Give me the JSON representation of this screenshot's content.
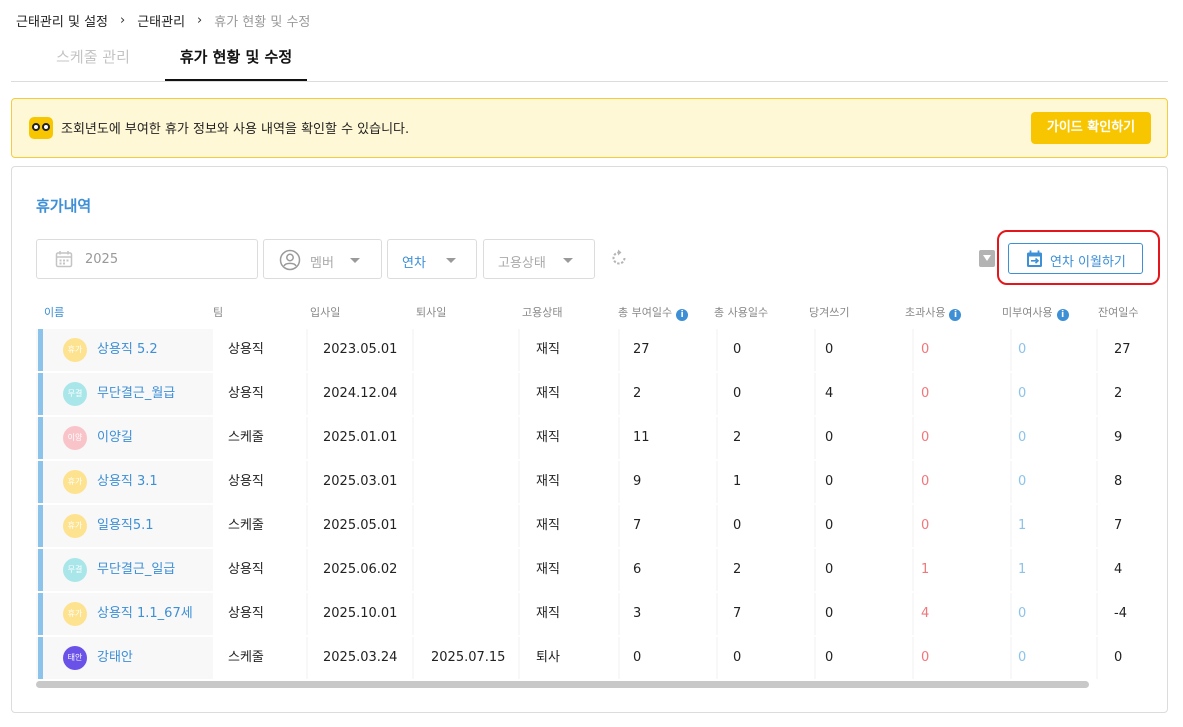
{
  "breadcrumb": {
    "items": [
      "근태관리 및 설정",
      "근태관리",
      "휴가 현황 및 수정"
    ],
    "separator": "›"
  },
  "tabs": [
    {
      "label": "스케줄 관리",
      "active": false
    },
    {
      "label": "휴가 현황 및 수정",
      "active": true
    }
  ],
  "notice": {
    "icon": "owl-mascot-icon",
    "message": "조회년도에 부여한 휴가 정보와 사용 내역을 확인할 수 있습니다.",
    "guide_button": "가이드 확인하기"
  },
  "section": {
    "title": "휴가내역"
  },
  "filters": {
    "year": "2025",
    "member_placeholder": "멤버",
    "leave_type": "연차",
    "employment_status_placeholder": "고용상태"
  },
  "actions": {
    "carryover_button": "연차 이월하기"
  },
  "table": {
    "columns": [
      "이름",
      "팀",
      "입사일",
      "퇴사일",
      "고용상태",
      "총 부여일수",
      "총 사용일수",
      "당겨쓰기",
      "초과사용",
      "미부여사용",
      "잔여일수"
    ],
    "info_icon": "i",
    "rows": [
      {
        "avatar": "휴가",
        "avatar_color": "#fde28f",
        "name": "상용직 5.2",
        "team": "상용직",
        "join": "2023.05.01",
        "leave": "",
        "status": "재직",
        "granted": "27",
        "used": "0",
        "advance": "0",
        "over": "0",
        "ungranted": "0",
        "remaining": "27"
      },
      {
        "avatar": "무결",
        "avatar_color": "#a9e6ea",
        "name": "무단결근_월급",
        "team": "상용직",
        "join": "2024.12.04",
        "leave": "",
        "status": "재직",
        "granted": "2",
        "used": "0",
        "advance": "4",
        "over": "0",
        "ungranted": "0",
        "remaining": "2"
      },
      {
        "avatar": "이양",
        "avatar_color": "#f9c4c9",
        "name": "이양길",
        "team": "스케줄",
        "join": "2025.01.01",
        "leave": "",
        "status": "재직",
        "granted": "11",
        "used": "2",
        "advance": "0",
        "over": "0",
        "ungranted": "0",
        "remaining": "9"
      },
      {
        "avatar": "휴가",
        "avatar_color": "#fde28f",
        "name": "상용직 3.1",
        "team": "상용직",
        "join": "2025.03.01",
        "leave": "",
        "status": "재직",
        "granted": "9",
        "used": "1",
        "advance": "0",
        "over": "0",
        "ungranted": "0",
        "remaining": "8"
      },
      {
        "avatar": "휴가",
        "avatar_color": "#fde28f",
        "name": "일용직5.1",
        "team": "스케줄",
        "join": "2025.05.01",
        "leave": "",
        "status": "재직",
        "granted": "7",
        "used": "0",
        "advance": "0",
        "over": "0",
        "ungranted": "1",
        "remaining": "7"
      },
      {
        "avatar": "무결",
        "avatar_color": "#a9e6ea",
        "name": "무단결근_일급",
        "team": "상용직",
        "join": "2025.06.02",
        "leave": "",
        "status": "재직",
        "granted": "6",
        "used": "2",
        "advance": "0",
        "over": "1",
        "ungranted": "1",
        "remaining": "4"
      },
      {
        "avatar": "휴가",
        "avatar_color": "#fde28f",
        "name": "상용직 1.1_67세",
        "team": "상용직",
        "join": "2025.10.01",
        "leave": "",
        "status": "재직",
        "granted": "3",
        "used": "7",
        "advance": "0",
        "over": "4",
        "ungranted": "0",
        "remaining": "-4"
      },
      {
        "avatar": "태안",
        "avatar_color": "#6a52e8",
        "name": "강태안",
        "team": "스케줄",
        "join": "2025.03.24",
        "leave": "2025.07.15",
        "status": "퇴사",
        "granted": "0",
        "used": "0",
        "advance": "0",
        "over": "0",
        "ungranted": "0",
        "remaining": "0"
      }
    ]
  },
  "colors": {
    "accent": "#3d8fd6",
    "notice_bg": "#fff8d6",
    "notice_button": "#f7c600",
    "highlight": "#e4161c",
    "over_value": "#f0777a",
    "ungranted_value": "#8cc3ea"
  }
}
